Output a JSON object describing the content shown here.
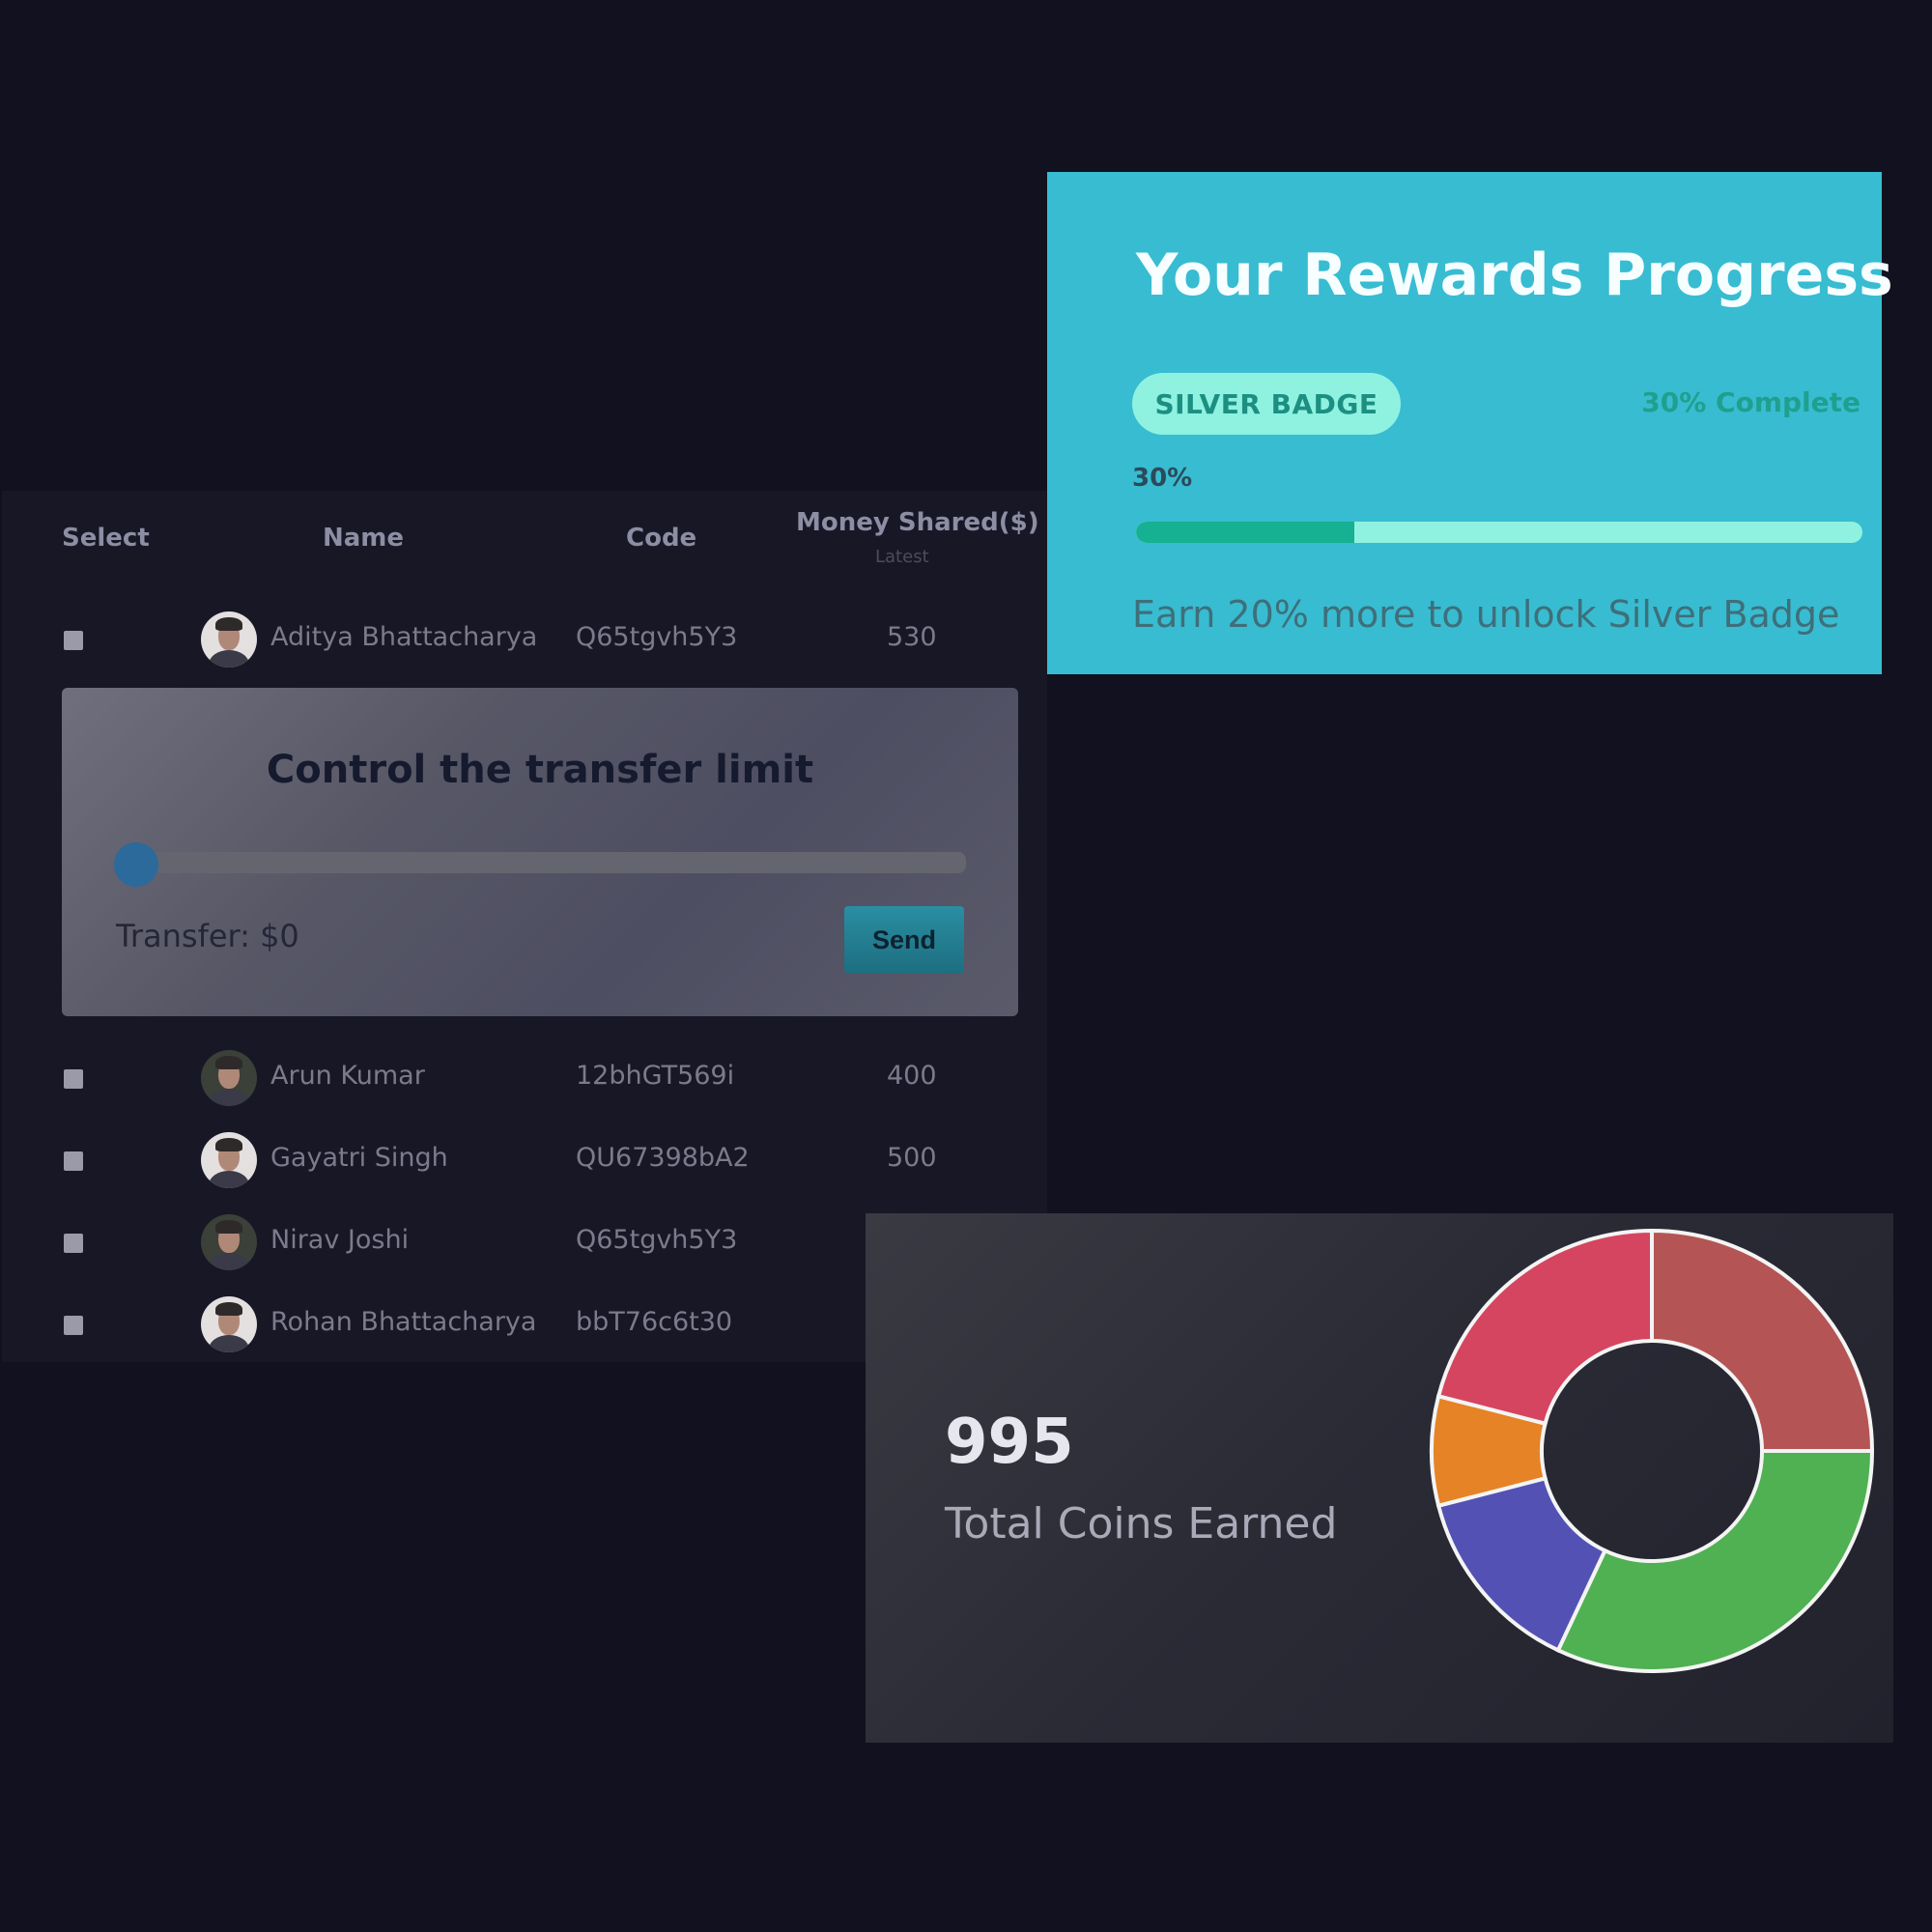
{
  "table": {
    "headers": {
      "select": "Select",
      "name": "Name",
      "code": "Code",
      "money": "Money Shared($)",
      "money_sub": "Latest"
    },
    "rows": [
      {
        "name": "Aditya Bhattacharya",
        "code": "Q65tgvh5Y3",
        "money": "530"
      },
      {
        "name": "Arun Kumar",
        "code": "12bhGT569i",
        "money": "400"
      },
      {
        "name": "Gayatri Singh",
        "code": "QU67398bA2",
        "money": "500"
      },
      {
        "name": "Nirav Joshi",
        "code": "Q65tgvh5Y3",
        "money": ""
      },
      {
        "name": "Rohan Bhattacharya",
        "code": "bbT76c6t30",
        "money": ""
      }
    ]
  },
  "transfer": {
    "title": "Control the transfer limit",
    "label": "Transfer: $0",
    "send_label": "Send",
    "slider_value_fraction": 0
  },
  "rewards": {
    "title": "Your Rewards Progress",
    "badge": "SILVER BADGE",
    "complete": "30% Complete",
    "percent": "30%",
    "progress_fraction": 0.3,
    "earn_text": "Earn 20% more to unlock Silver Badge",
    "colors": {
      "card": "#38bcd1",
      "fill": "#16b093",
      "track": "#8ff2e0"
    }
  },
  "coins": {
    "value": "995",
    "label": "Total Coins Earned"
  },
  "chart_data": {
    "type": "pie",
    "donut": true,
    "slices": [
      {
        "value": 25,
        "color": "#b55454"
      },
      {
        "value": 32,
        "color": "#4fb152"
      },
      {
        "value": 14,
        "color": "#5352b4"
      },
      {
        "value": 8,
        "color": "#e58326"
      },
      {
        "value": 21,
        "color": "#d54560"
      }
    ]
  }
}
